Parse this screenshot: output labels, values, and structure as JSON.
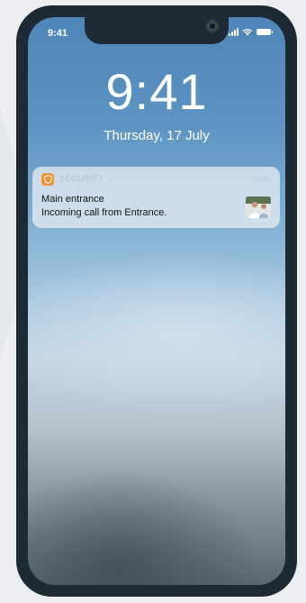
{
  "status_bar": {
    "time": "9:41"
  },
  "lock_screen": {
    "time": "9:41",
    "date": "Thursday, 17 July"
  },
  "notification": {
    "app_name": "SECURITY",
    "time": "now",
    "title": "Main entrance",
    "body": "Incoming call from Entrance.",
    "app_icon": "shield-icon",
    "app_color": "#f3902f"
  },
  "colors": {
    "phone_frame": "#1d2a34",
    "page_background": "#eceef1"
  }
}
